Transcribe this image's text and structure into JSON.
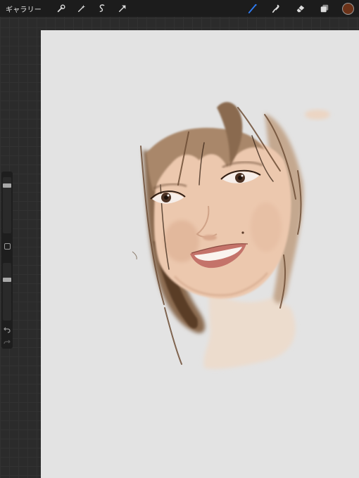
{
  "toolbar": {
    "gallery_label": "ギャラリー",
    "left_icons": [
      "wrench-icon",
      "magic-wand-icon",
      "selection-icon",
      "transform-arrow-icon"
    ],
    "right_icons": [
      "brush-icon",
      "smudge-icon",
      "eraser-icon",
      "layers-icon"
    ],
    "active_tool": "brush",
    "active_color": "#6b3218",
    "accent_color": "#2f7df6"
  },
  "sidebar": {
    "brush_size_level": 0.12,
    "opacity_level": 0.27
  },
  "canvas": {
    "background": "#e3e3e3",
    "artwork": "painted-portrait"
  }
}
